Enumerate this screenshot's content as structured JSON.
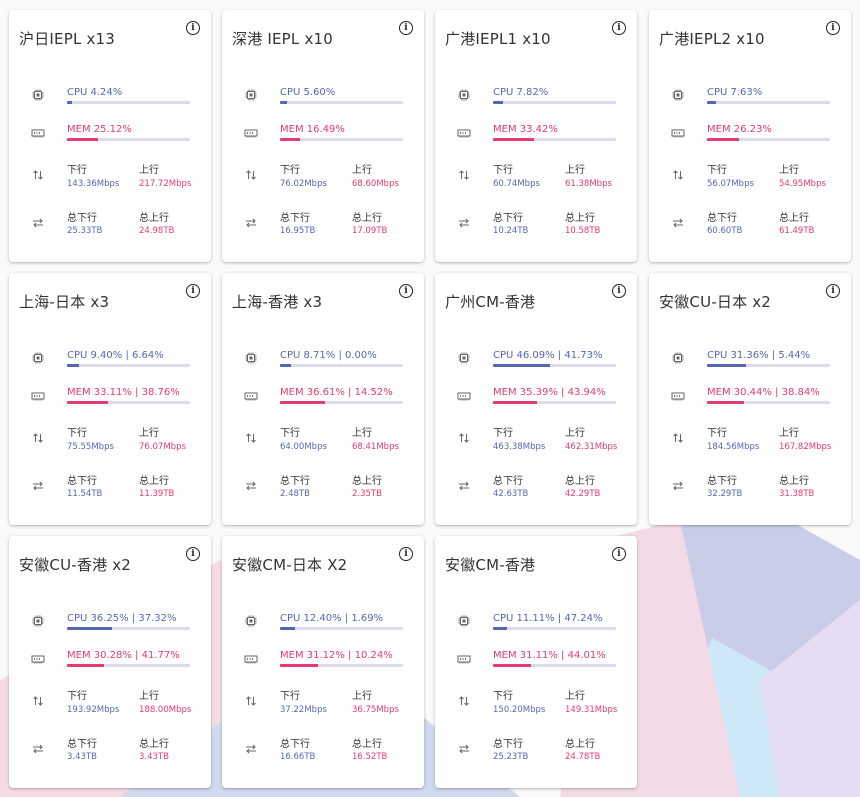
{
  "labels": {
    "down": "下行",
    "up": "上行",
    "total_down": "总下行",
    "total_up": "总上行",
    "info_glyph": "i"
  },
  "colors": {
    "cpu": "#5865b5",
    "mem": "#e23c72",
    "bar_track": "#dcdcec"
  },
  "icons": [
    "info-icon",
    "cpu-chip-icon",
    "memory-icon",
    "transfer-vertical-icon",
    "transfer-horizontal-icon"
  ],
  "cards": [
    {
      "title": "沪日IEPL x13",
      "cpu": "CPU 4.24%",
      "cpu_pct": 4.24,
      "mem": "MEM 25.12%",
      "mem_pct": 25.12,
      "down": "143.36Mbps",
      "up": "217.72Mbps",
      "total_down": "25.33TB",
      "total_up": "24.98TB"
    },
    {
      "title": "深港 IEPL x10",
      "cpu": "CPU 5.60%",
      "cpu_pct": 5.6,
      "mem": "MEM 16.49%",
      "mem_pct": 16.49,
      "down": "76.02Mbps",
      "up": "68.60Mbps",
      "total_down": "16.95TB",
      "total_up": "17.09TB"
    },
    {
      "title": "广港IEPL1 x10",
      "cpu": "CPU 7.82%",
      "cpu_pct": 7.82,
      "mem": "MEM 33.42%",
      "mem_pct": 33.42,
      "down": "60.74Mbps",
      "up": "61.38Mbps",
      "total_down": "10.24TB",
      "total_up": "10.58TB"
    },
    {
      "title": "广港IEPL2 x10",
      "cpu": "CPU 7.63%",
      "cpu_pct": 7.63,
      "mem": "MEM 26.23%",
      "mem_pct": 26.23,
      "down": "56.07Mbps",
      "up": "54.95Mbps",
      "total_down": "60.60TB",
      "total_up": "61.49TB"
    },
    {
      "title": "上海-日本 x3",
      "cpu": "CPU 9.40% | 6.64%",
      "cpu_pct": 9.4,
      "mem": "MEM 33.11% | 38.76%",
      "mem_pct": 33.11,
      "down": "75.55Mbps",
      "up": "76.07Mbps",
      "total_down": "11.54TB",
      "total_up": "11.39TB"
    },
    {
      "title": "上海-香港 x3",
      "cpu": "CPU 8.71% | 0.00%",
      "cpu_pct": 8.71,
      "mem": "MEM 36.61% | 14.52%",
      "mem_pct": 36.61,
      "down": "64.00Mbps",
      "up": "68.41Mbps",
      "total_down": "2.48TB",
      "total_up": "2.35TB"
    },
    {
      "title": "广州CM-香港",
      "cpu": "CPU 46.09% | 41.73%",
      "cpu_pct": 46.09,
      "mem": "MEM 35.39% | 43.94%",
      "mem_pct": 35.39,
      "down": "463.38Mbps",
      "up": "462.31Mbps",
      "total_down": "42.63TB",
      "total_up": "42.29TB"
    },
    {
      "title": "安徽CU-日本 x2",
      "cpu": "CPU 31.36% | 5.44%",
      "cpu_pct": 31.36,
      "mem": "MEM 30.44% | 38.84%",
      "mem_pct": 30.44,
      "down": "184.56Mbps",
      "up": "167.82Mbps",
      "total_down": "32.29TB",
      "total_up": "31.38TB"
    },
    {
      "title": "安徽CU-香港 x2",
      "cpu": "CPU 36.25% | 37.32%",
      "cpu_pct": 36.25,
      "mem": "MEM 30.28% | 41.77%",
      "mem_pct": 30.28,
      "down": "193.92Mbps",
      "up": "188.00Mbps",
      "total_down": "3.43TB",
      "total_up": "3.43TB"
    },
    {
      "title": "安徽CM-日本 X2",
      "cpu": "CPU 12.40% | 1.69%",
      "cpu_pct": 12.4,
      "mem": "MEM 31.12% | 10.24%",
      "mem_pct": 31.12,
      "down": "37.22Mbps",
      "up": "36.75Mbps",
      "total_down": "16.66TB",
      "total_up": "16.52TB"
    },
    {
      "title": "安徽CM-香港",
      "cpu": "CPU 11.11% | 47.24%",
      "cpu_pct": 11.11,
      "mem": "MEM 31.11% | 44.01%",
      "mem_pct": 31.11,
      "down": "150.20Mbps",
      "up": "149.31Mbps",
      "total_down": "25.23TB",
      "total_up": "24.78TB"
    }
  ]
}
